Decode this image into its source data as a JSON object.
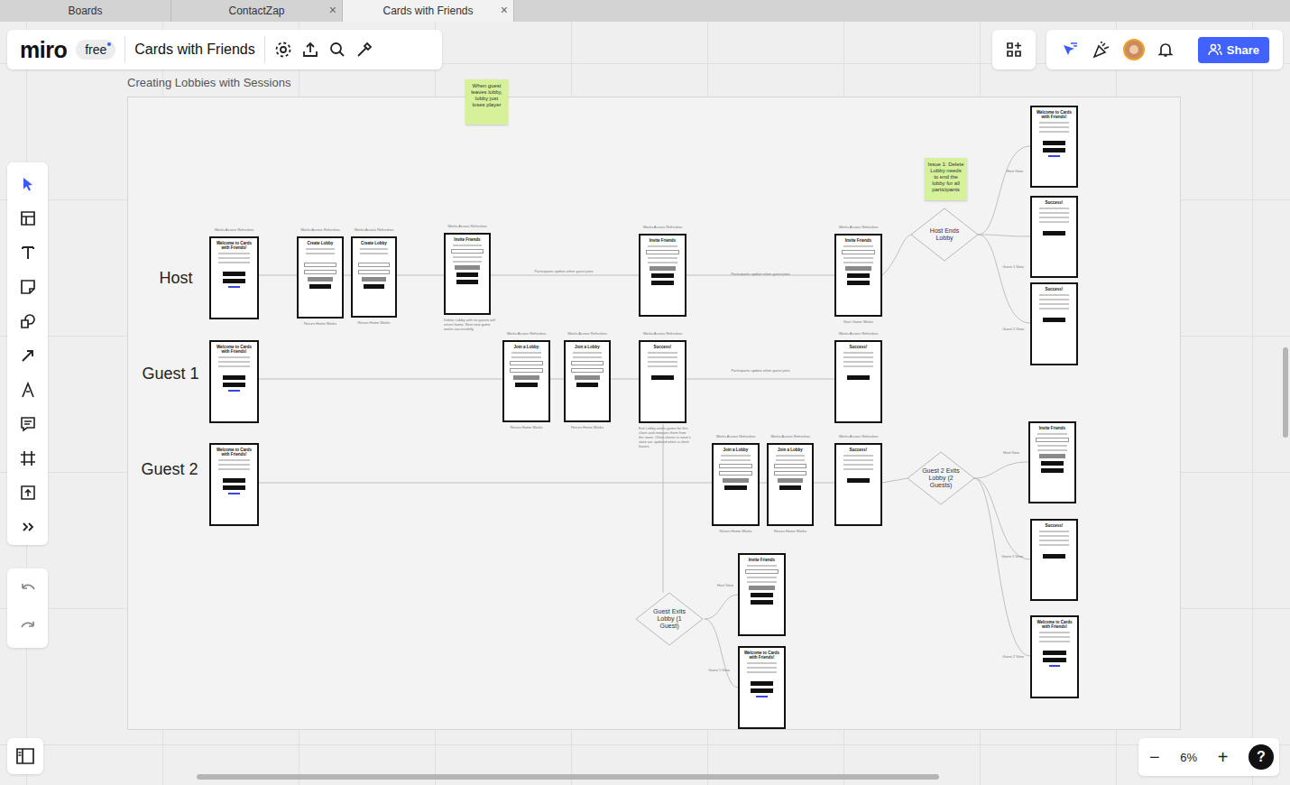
{
  "browser_tabs": [
    {
      "label": "Boards",
      "selected": false,
      "closable": false
    },
    {
      "label": "ContactZap",
      "selected": false,
      "closable": true
    },
    {
      "label": "Cards with Friends",
      "selected": true,
      "closable": true
    }
  ],
  "close_glyph": "×",
  "toolbar": {
    "logo": "miro",
    "plan": "free",
    "board_title": "Cards with Friends"
  },
  "share": "Share",
  "frame": {
    "title": "Creating Lobbies with Sessions"
  },
  "lanes": [
    "Host",
    "Guest 1",
    "Guest 2"
  ],
  "stickies": [
    "When guest leaves lobby, lobby just loses player",
    "Issue 1: Delete Lobby needs to end the lobby for all participants"
  ],
  "decisions": [
    "Host Ends Lobby",
    "Guest 2 Exits Lobby (2 Guests)",
    "Guest Exits Lobby (1 Guest)"
  ],
  "screens": [
    {
      "kind": "welcome",
      "title": "Welcome to Cards with Friends!",
      "top_note": "Works Across Refreshes"
    },
    {
      "kind": "welcome",
      "title": "Welcome to Cards with Friends!"
    },
    {
      "kind": "welcome",
      "title": "Welcome to Cards with Friends!"
    },
    {
      "kind": "create",
      "title": "Create Lobby",
      "top_note": "Works Across Refreshes",
      "bottom_note": "Return Home Works"
    },
    {
      "kind": "create",
      "title": "Create Lobby",
      "top_note": "Works Across Refreshes",
      "bottom_note": "Return Home Works"
    },
    {
      "kind": "invite",
      "title": "Invite Friends",
      "top_note": "Works Across Refreshes",
      "bottom_note": "Delete Lobby with no guests will return home. Next new game works successfully"
    },
    {
      "kind": "join",
      "title": "Join a Lobby",
      "top_note": "Works Across Refreshes",
      "bottom_note": "Return Home Works"
    },
    {
      "kind": "join",
      "title": "Join a Lobby",
      "top_note": "Works Across Refreshes",
      "bottom_note": "Return Home Works"
    },
    {
      "kind": "invite",
      "title": "Invite Friends",
      "top_note": "Works Across Refreshes"
    },
    {
      "kind": "success",
      "title": "Success!",
      "top_note": "Works Across Refreshes",
      "bottom_note": "Exit Lobby works game for this client and removes them from the room. Other clients in room's state are updated when a client leaves"
    },
    {
      "kind": "join",
      "title": "Join a Lobby",
      "top_note": "Works Across Refreshes",
      "bottom_note": "Return Home Works"
    },
    {
      "kind": "join",
      "title": "Join a Lobby",
      "top_note": "Works Across Refreshes",
      "bottom_note": "Return Home Works"
    },
    {
      "kind": "invite",
      "title": "Invite Friends",
      "top_note": "Works Across Refreshes",
      "bottom_note": "Start Game Works"
    },
    {
      "kind": "success",
      "title": "Success!",
      "top_note": "Works Across Refreshes"
    },
    {
      "kind": "success",
      "title": "Success!",
      "top_note": "Works Across Refreshes"
    },
    {
      "kind": "welcome",
      "title": "Welcome to Cards with Friends!"
    },
    {
      "kind": "success",
      "title": "Success!"
    },
    {
      "kind": "success",
      "title": "Success!"
    },
    {
      "kind": "invite",
      "title": "Invite Friends"
    },
    {
      "kind": "success",
      "title": "Success!"
    },
    {
      "kind": "welcome",
      "title": "Welcome to Cards with Friends!"
    },
    {
      "kind": "invite",
      "title": "Invite Friends"
    },
    {
      "kind": "welcome",
      "title": "Welcome to Cards with Friends!"
    }
  ],
  "connector_labels": [
    "Participants update when guest joins",
    "Participants update when guest joins",
    "Participants update when guest joins",
    "Host View",
    "Guest 1 View",
    "Guest 2 View",
    "Host View",
    "Guest 1 View",
    "Guest 2 View",
    "Host View",
    "Guest 1 View"
  ],
  "zoom": {
    "minus": "−",
    "level": "6%",
    "plus": "+",
    "help": "?"
  }
}
